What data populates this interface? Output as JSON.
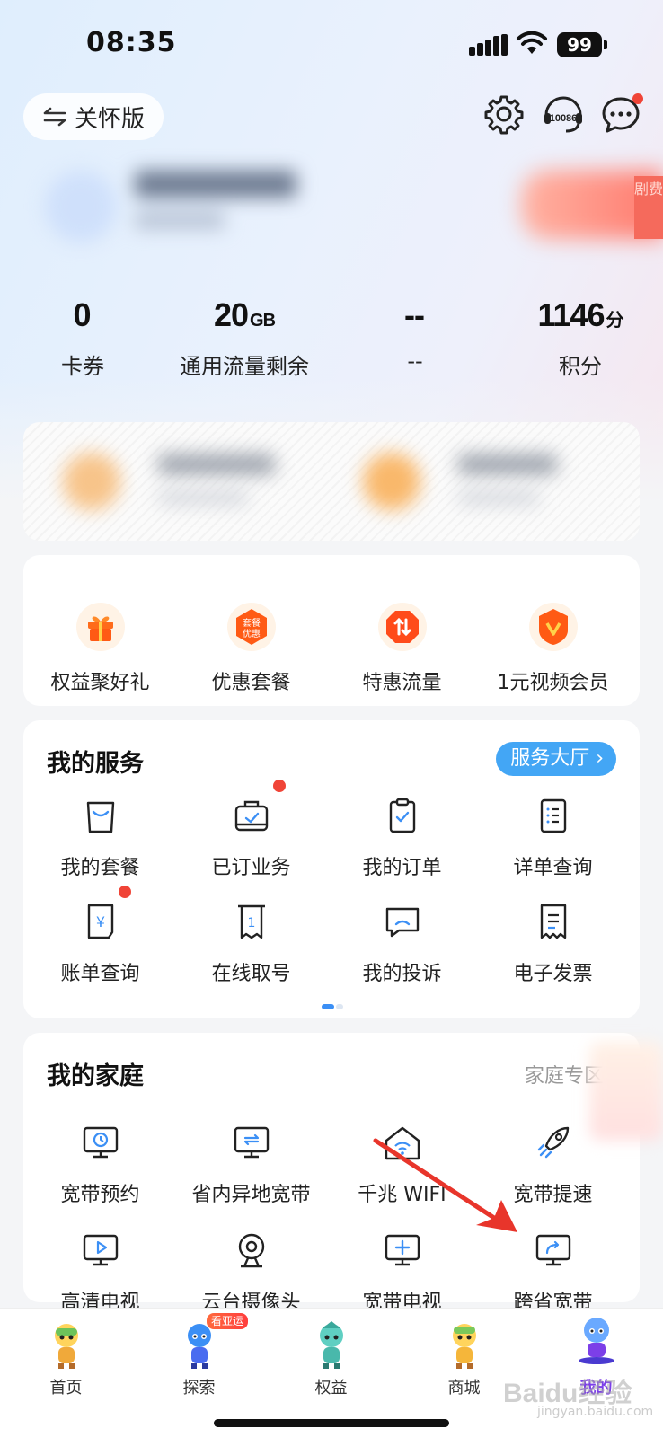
{
  "status_bar": {
    "time": "08:35",
    "battery": "99"
  },
  "header": {
    "care_mode_label": "关怀版",
    "hotline": "10086"
  },
  "stats": [
    {
      "value": "0",
      "unit": "",
      "label": "卡券"
    },
    {
      "value": "20",
      "unit": "GB",
      "label": "通用流量剩余"
    },
    {
      "value": "--",
      "unit": "",
      "label": "--"
    },
    {
      "value": "1146",
      "unit": "分",
      "label": "积分"
    }
  ],
  "promo_banner": {
    "side_tag": "剧费"
  },
  "quick_actions": [
    {
      "label": "权益聚好礼",
      "icon": "gift-icon"
    },
    {
      "label": "优惠套餐",
      "icon": "discount-package-icon",
      "icon_text": "套餐优惠"
    },
    {
      "label": "特惠流量",
      "icon": "data-traffic-icon"
    },
    {
      "label": "1元视频会员",
      "icon": "video-vip-icon"
    }
  ],
  "services": {
    "title": "我的服务",
    "hall_button": "服务大厅",
    "items": [
      {
        "label": "我的套餐",
        "icon": "package-bag-icon",
        "dot": false
      },
      {
        "label": "已订业务",
        "icon": "subscribed-service-icon",
        "dot": true
      },
      {
        "label": "我的订单",
        "icon": "order-clipboard-icon",
        "dot": false
      },
      {
        "label": "详单查询",
        "icon": "detail-list-icon",
        "dot": false
      },
      {
        "label": "账单查询",
        "icon": "bill-yuan-icon",
        "dot": true
      },
      {
        "label": "在线取号",
        "icon": "queue-ticket-icon",
        "dot": false
      },
      {
        "label": "我的投诉",
        "icon": "complaint-chat-icon",
        "dot": false
      },
      {
        "label": "电子发票",
        "icon": "e-invoice-icon",
        "dot": false
      }
    ]
  },
  "family": {
    "title": "我的家庭",
    "link": "家庭专区",
    "items": [
      {
        "label": "宽带预约",
        "icon": "broadband-appointment-icon"
      },
      {
        "label": "省内异地宽带",
        "icon": "broadband-relocate-icon"
      },
      {
        "label": "千兆 WIFI",
        "icon": "gigabit-wifi-icon"
      },
      {
        "label": "宽带提速",
        "icon": "rocket-icon"
      },
      {
        "label": "高清电视",
        "icon": "hd-tv-icon"
      },
      {
        "label": "云台摄像头",
        "icon": "camera-icon"
      },
      {
        "label": "宽带电视",
        "icon": "broadband-tv-icon"
      },
      {
        "label": "跨省宽带",
        "icon": "cross-province-broadband-icon"
      }
    ]
  },
  "tabbar": {
    "tabs": [
      {
        "label": "首页",
        "active": false
      },
      {
        "label": "探索",
        "active": false,
        "badge": "看亚运"
      },
      {
        "label": "权益",
        "active": false
      },
      {
        "label": "商城",
        "active": false
      },
      {
        "label": "我的",
        "active": true
      }
    ]
  },
  "watermark": {
    "brand": "Baidu经验",
    "url": "jingyan.baidu.com"
  },
  "colors": {
    "accent_blue": "#43a6f5",
    "badge_red": "#f04437",
    "active_tab": "#7c3fe8",
    "annotation_arrow": "#e8352b"
  }
}
